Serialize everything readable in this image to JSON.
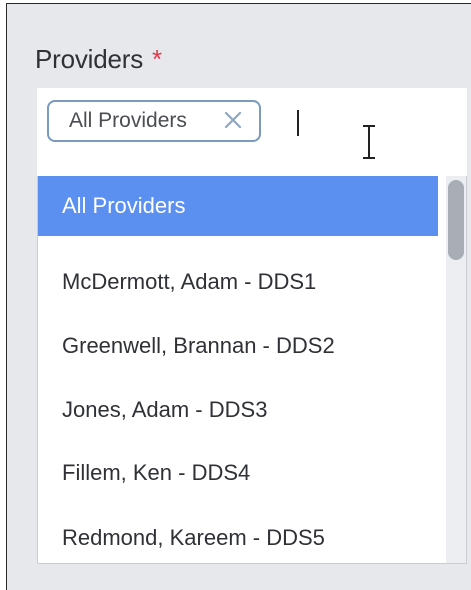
{
  "field": {
    "label": "Providers",
    "required_marker": "*"
  },
  "select": {
    "chips": [
      {
        "label": "All Providers"
      }
    ]
  },
  "dropdown": {
    "options": [
      {
        "label": "All Providers",
        "highlighted": true
      },
      {
        "label": "McDermott, Adam - DDS1",
        "highlighted": false
      },
      {
        "label": "Greenwell, Brannan - DDS2",
        "highlighted": false
      },
      {
        "label": "Jones, Adam - DDS3",
        "highlighted": false
      },
      {
        "label": "Fillem, Ken - DDS4",
        "highlighted": false
      },
      {
        "label": "Redmond, Kareem - DDS5",
        "highlighted": false
      }
    ]
  },
  "colors": {
    "highlight": "#5b8ff0",
    "required": "#e0384a",
    "chip_border": "#7a9bbd",
    "panel_bg": "#e6e8ec"
  },
  "icons": {
    "chip_remove": "close-icon",
    "cursor": "ibeam-cursor-icon"
  }
}
